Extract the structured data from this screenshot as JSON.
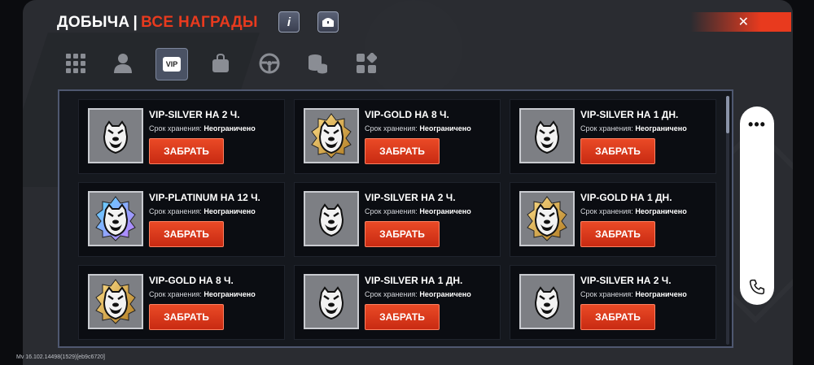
{
  "header": {
    "title": "ДОБЫЧА",
    "separator": "|",
    "subtitle": "ВСЕ НАГРАДЫ",
    "info_label": "i",
    "close_label": "✕"
  },
  "tabs": [
    {
      "name": "tab-all",
      "icon": "grid-icon"
    },
    {
      "name": "tab-character",
      "icon": "person-icon"
    },
    {
      "name": "tab-vip",
      "icon": "vip-icon",
      "label": "VIP",
      "active": true
    },
    {
      "name": "tab-bag",
      "icon": "bag-icon"
    },
    {
      "name": "tab-car",
      "icon": "steering-wheel-icon"
    },
    {
      "name": "tab-money",
      "icon": "coins-icon"
    },
    {
      "name": "tab-other",
      "icon": "apps-icon"
    }
  ],
  "rewards": [
    {
      "title": "VIP-SILVER НА 2 Ч.",
      "tier": "silver"
    },
    {
      "title": "VIP-GOLD НА 8 Ч.",
      "tier": "gold"
    },
    {
      "title": "VIP-SILVER НА 1 ДН.",
      "tier": "silver"
    },
    {
      "title": "VIP-PLATINUM НА 12 Ч.",
      "tier": "platinum"
    },
    {
      "title": "VIP-SILVER НА 2 Ч.",
      "tier": "silver"
    },
    {
      "title": "VIP-GOLD НА 1 ДН.",
      "tier": "gold"
    },
    {
      "title": "VIP-GOLD НА 8 Ч.",
      "tier": "gold"
    },
    {
      "title": "VIP-SILVER НА 1 ДН.",
      "tier": "silver"
    },
    {
      "title": "VIP-SILVER НА 2 Ч.",
      "tier": "silver"
    }
  ],
  "common": {
    "storage_label": "Срок хранения:",
    "storage_value": "Неограничено",
    "claim_label": "ЗАБРАТЬ"
  },
  "side": {
    "menu": "•••",
    "icon": "phone-icon"
  },
  "version": "Mv 16.102.14498(1529)[eb9c6720]",
  "colors": {
    "accent": "#e83a1e",
    "panel": "#2a2c31",
    "grid_border": "#4f5870"
  }
}
